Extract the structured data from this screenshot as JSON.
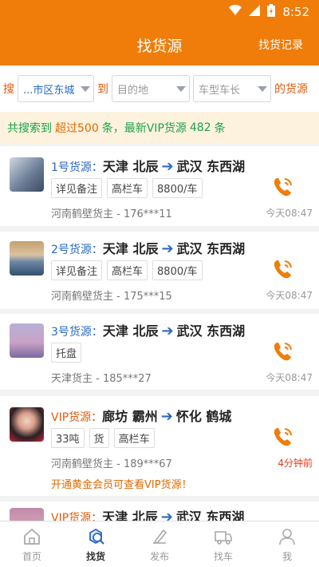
{
  "status": {
    "time": "8:52"
  },
  "header": {
    "title": "找货源",
    "right_link": "找货记录"
  },
  "search": {
    "prefix": "搜",
    "origin": "...市区东城",
    "to": "到",
    "destination_placeholder": "目的地",
    "vehicle_placeholder": "车型车长",
    "suffix": "的货源"
  },
  "summary": {
    "p1": "共搜索到",
    "total": "超过500",
    "p2": "条，最新VIP货源",
    "vip_count": "482",
    "p3": "条"
  },
  "listings": [
    {
      "no": "1号货源：",
      "from": "天津 北辰",
      "to": "武汉 东西湖",
      "tags": [
        "详见备注",
        "高栏车",
        "8800/车"
      ],
      "owner": "河南鹤壁货主 - 176***11",
      "time": "今天08:47"
    },
    {
      "no": "2号货源：",
      "from": "天津 北辰",
      "to": "武汉 东西湖",
      "tags": [
        "详见备注",
        "高栏车",
        "8800/车"
      ],
      "owner": "河南鹤壁货主 - 175***15",
      "time": "今天08:47"
    },
    {
      "no": "3号货源：",
      "from": "天津 北辰",
      "to": "武汉 东西湖",
      "tags": [
        "托盘"
      ],
      "owner": "天津货主 - 185***27",
      "time": "今天08:47"
    },
    {
      "no": "VIP货源：",
      "from": "廊坊 霸州",
      "to": "怀化 鹤城",
      "tags": [
        "33吨",
        "货",
        "高栏车"
      ],
      "owner": "河南鹤壁货主 - 189***67",
      "time": "4分钟前",
      "promo": "开通黄金会员可查看VIP货源！"
    },
    {
      "no": "VIP货源：",
      "from": "天津 北辰",
      "to": "武汉 东西湖"
    }
  ],
  "tabs": [
    {
      "label": "首页",
      "icon": "home-icon"
    },
    {
      "label": "找货",
      "icon": "find-cargo-icon"
    },
    {
      "label": "发布",
      "icon": "publish-icon"
    },
    {
      "label": "找车",
      "icon": "truck-icon"
    },
    {
      "label": "我",
      "icon": "user-icon"
    }
  ],
  "colors": {
    "brand": "#f07d0a",
    "link": "#2a68c4",
    "vip": "#e55a0a"
  }
}
